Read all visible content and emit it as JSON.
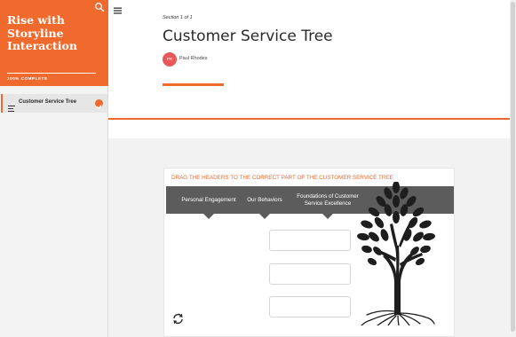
{
  "sidebar": {
    "course_title": "Rise with Storyline Interaction",
    "search_icon": "search-icon",
    "progress_percent": 100,
    "progress_label": "100% COMPLETE",
    "lessons": [
      {
        "label": "Customer Service Tree",
        "icon": "list-icon",
        "status": "complete",
        "status_icon": "check-icon"
      }
    ]
  },
  "main": {
    "menu_icon": "hamburger-menu-icon",
    "section_label": "Section 1 of 1",
    "lesson_title": "Customer Service Tree",
    "author": {
      "initials": "PR",
      "name": "Paul Rhodes"
    }
  },
  "interaction": {
    "instruction": "DRAG THE HEADERS TO THE CORRECT PART OF THE CUSTOMER SERVICE TREE",
    "headers": [
      "Personal Engagement",
      "Our Behaviors",
      "Foundations of Customer Service Excellence"
    ],
    "drop_zone_count": 3,
    "tree_image": "tree-icon",
    "reset_icon": "reset-icon"
  },
  "colors": {
    "accent": "#f06a2d",
    "header_bar": "#5c5c5c",
    "avatar": "#e8575a",
    "content_bg": "#f2f2f2"
  }
}
